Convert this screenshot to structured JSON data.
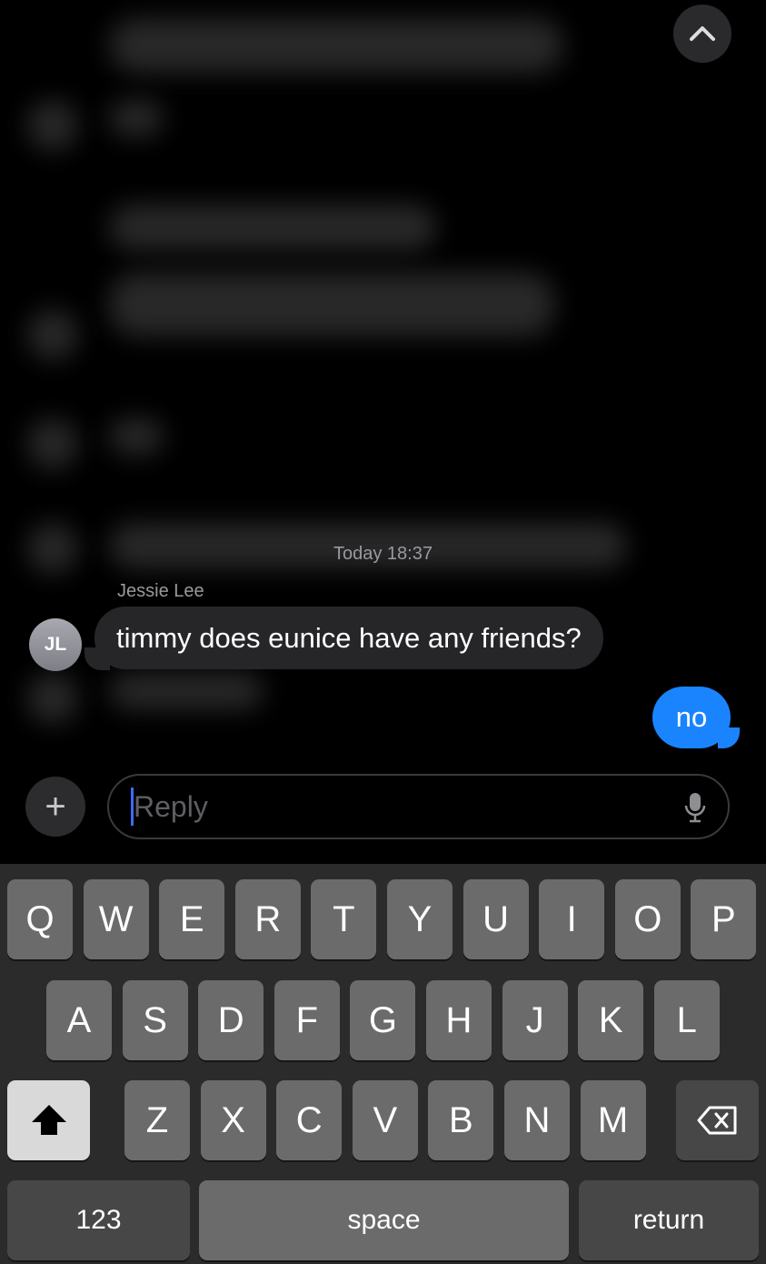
{
  "conversation": {
    "timestamp": "Today 18:37",
    "sender": "Jessie Lee",
    "sender_initials": "JL",
    "incoming_message": "timmy does eunice have any friends?",
    "outgoing_message": "no",
    "accent_color": "#1a84ff"
  },
  "composer": {
    "placeholder": "Reply",
    "plus_icon": "plus-icon",
    "mic_icon": "microphone-icon"
  },
  "scroll_up_icon": "chevron-up-icon",
  "keyboard": {
    "row1": [
      "Q",
      "W",
      "E",
      "R",
      "T",
      "Y",
      "U",
      "I",
      "O",
      "P"
    ],
    "row2": [
      "A",
      "S",
      "D",
      "F",
      "G",
      "H",
      "J",
      "K",
      "L"
    ],
    "row3": [
      "Z",
      "X",
      "C",
      "V",
      "B",
      "N",
      "M"
    ],
    "numbers": "123",
    "space": "space",
    "return": "return"
  }
}
